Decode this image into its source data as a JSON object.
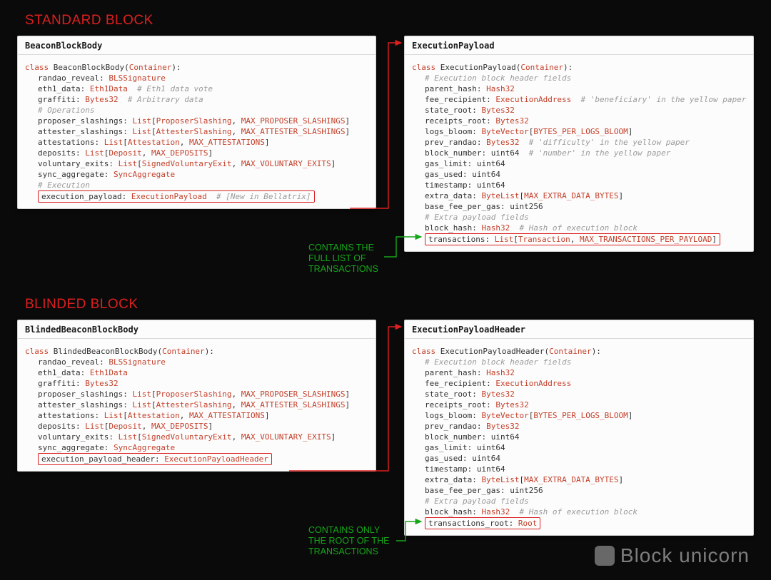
{
  "section_titles": {
    "standard": "STANDARD BLOCK",
    "blinded": "BLINDED BLOCK"
  },
  "bbb": {
    "title": "BeaconBlockBody",
    "class_kw": "class ",
    "class_name": "BeaconBlockBody",
    "container": "Container",
    "l1_name": "randao_reveal: ",
    "l1_type": "BLSSignature",
    "l2_name": "eth1_data: ",
    "l2_type": "Eth1Data",
    "l2_cmt": "  # Eth1 data vote",
    "l3_name": "graffiti: ",
    "l3_type": "Bytes32",
    "l3_cmt": "  # Arbitrary data",
    "l4_cmt": "# Operations",
    "l5_name": "proposer_slashings: ",
    "l5_list": "List",
    "l5_a": "ProposerSlashing",
    "l5_b": "MAX_PROPOSER_SLASHINGS",
    "l6_name": "attester_slashings: ",
    "l6_list": "List",
    "l6_a": "AttesterSlashing",
    "l6_b": "MAX_ATTESTER_SLASHINGS",
    "l7_name": "attestations: ",
    "l7_list": "List",
    "l7_a": "Attestation",
    "l7_b": "MAX_ATTESTATIONS",
    "l8_name": "deposits: ",
    "l8_list": "List",
    "l8_a": "Deposit",
    "l8_b": "MAX_DEPOSITS",
    "l9_name": "voluntary_exits: ",
    "l9_list": "List",
    "l9_a": "SignedVoluntaryExit",
    "l9_b": "MAX_VOLUNTARY_EXITS",
    "l10_name": "sync_aggregate: ",
    "l10_type": "SyncAggregate",
    "l11_cmt": "# Execution",
    "l12_name": "execution_payload: ",
    "l12_type": "ExecutionPayload",
    "l12_cmt": "  # [New in Bellatrix]"
  },
  "ep": {
    "title": "ExecutionPayload",
    "class_kw": "class ",
    "class_name": "ExecutionPayload",
    "container": "Container",
    "c1": "# Execution block header fields",
    "f1n": "parent_hash: ",
    "f1t": "Hash32",
    "f2n": "fee_recipient: ",
    "f2t": "ExecutionAddress",
    "f2c": "  # 'beneficiary' in the yellow paper",
    "f3n": "state_root: ",
    "f3t": "Bytes32",
    "f4n": "receipts_root: ",
    "f4t": "Bytes32",
    "f5n": "logs_bloom: ",
    "f5l": "ByteVector",
    "f5b": "BYTES_PER_LOGS_BLOOM",
    "f6n": "prev_randao: ",
    "f6t": "Bytes32",
    "f6c": "  # 'difficulty' in the yellow paper",
    "f7n": "block_number: ",
    "f7t": "uint64",
    "f7c": "  # 'number' in the yellow paper",
    "f8n": "gas_limit: ",
    "f8t": "uint64",
    "f9n": "gas_used: ",
    "f9t": "uint64",
    "f10n": "timestamp: ",
    "f10t": "uint64",
    "f11n": "extra_data: ",
    "f11l": "ByteList",
    "f11b": "MAX_EXTRA_DATA_BYTES",
    "f12n": "base_fee_per_gas: ",
    "f12t": "uint256",
    "c2": "# Extra payload fields",
    "f13n": "block_hash: ",
    "f13t": "Hash32",
    "f13c": "  # Hash of execution block",
    "f14n": "transactions: ",
    "f14l": "List",
    "f14a": "Transaction",
    "f14b": "MAX_TRANSACTIONS_PER_PAYLOAD"
  },
  "bbbb": {
    "title": "BlindedBeaconBlockBody",
    "class_kw": "class ",
    "class_name": "BlindedBeaconBlockBody",
    "container": "Container",
    "l1_name": "randao_reveal: ",
    "l1_type": "BLSSignature",
    "l2_name": "eth1_data: ",
    "l2_type": "Eth1Data",
    "l3_name": "graffiti: ",
    "l3_type": "Bytes32",
    "l5_name": "proposer_slashings: ",
    "l5_list": "List",
    "l5_a": "ProposerSlashing",
    "l5_b": "MAX_PROPOSER_SLASHINGS",
    "l6_name": "attester_slashings: ",
    "l6_list": "List",
    "l6_a": "AttesterSlashing",
    "l6_b": "MAX_ATTESTER_SLASHINGS",
    "l7_name": "attestations: ",
    "l7_list": "List",
    "l7_a": "Attestation",
    "l7_b": "MAX_ATTESTATIONS",
    "l8_name": "deposits: ",
    "l8_list": "List",
    "l8_a": "Deposit",
    "l8_b": "MAX_DEPOSITS",
    "l9_name": "voluntary_exits: ",
    "l9_list": "List",
    "l9_a": "SignedVoluntaryExit",
    "l9_b": "MAX_VOLUNTARY_EXITS",
    "l10_name": "sync_aggregate: ",
    "l10_type": "SyncAggregate",
    "l12_name": "execution_payload_header: ",
    "l12_type": "ExecutionPayloadHeader"
  },
  "eph": {
    "title": "ExecutionPayloadHeader",
    "class_kw": "class ",
    "class_name": "ExecutionPayloadHeader",
    "container": "Container",
    "c1": "# Execution block header fields",
    "f1n": "parent_hash: ",
    "f1t": "Hash32",
    "f2n": "fee_recipient: ",
    "f2t": "ExecutionAddress",
    "f3n": "state_root: ",
    "f3t": "Bytes32",
    "f4n": "receipts_root: ",
    "f4t": "Bytes32",
    "f5n": "logs_bloom: ",
    "f5l": "ByteVector",
    "f5b": "BYTES_PER_LOGS_BLOOM",
    "f6n": "prev_randao: ",
    "f6t": "Bytes32",
    "f7n": "block_number: ",
    "f7t": "uint64",
    "f8n": "gas_limit: ",
    "f8t": "uint64",
    "f9n": "gas_used: ",
    "f9t": "uint64",
    "f10n": "timestamp: ",
    "f10t": "uint64",
    "f11n": "extra_data: ",
    "f11l": "ByteList",
    "f11b": "MAX_EXTRA_DATA_BYTES",
    "f12n": "base_fee_per_gas: ",
    "f12t": "uint256",
    "c2": "# Extra payload fields",
    "f13n": "block_hash: ",
    "f13t": "Hash32",
    "f13c": "  # Hash of execution block",
    "f14n": "transactions_root: ",
    "f14t": "Root"
  },
  "annot1": {
    "l1": "CONTAINS THE",
    "l2": "FULL LIST OF",
    "l3": "TRANSACTIONS"
  },
  "annot2": {
    "l1": "CONTAINS ONLY",
    "l2": "THE ROOT OF THE",
    "l3": "TRANSACTIONS"
  },
  "watermark": "Block unicorn"
}
